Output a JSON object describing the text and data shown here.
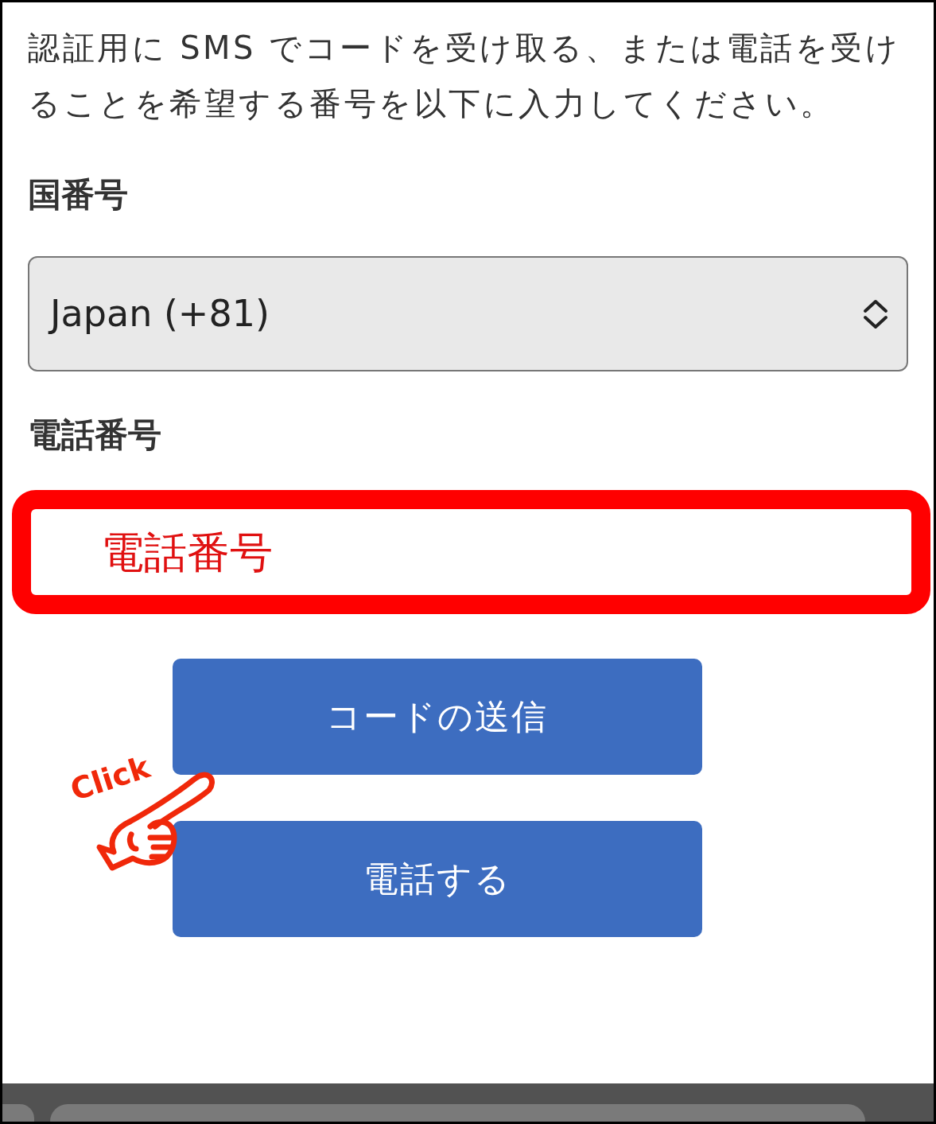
{
  "instructions": "認証用に SMS でコードを受け取る、または電話を受けることを希望する番号を以下に入力してください。",
  "country_code": {
    "label": "国番号",
    "value": "Japan (+81)"
  },
  "phone_number": {
    "label": "電話番号",
    "placeholder": "電話番号",
    "highlighted": true
  },
  "buttons": [
    "コードの送信",
    "電話する"
  ],
  "annotation": {
    "text": "Click"
  }
}
